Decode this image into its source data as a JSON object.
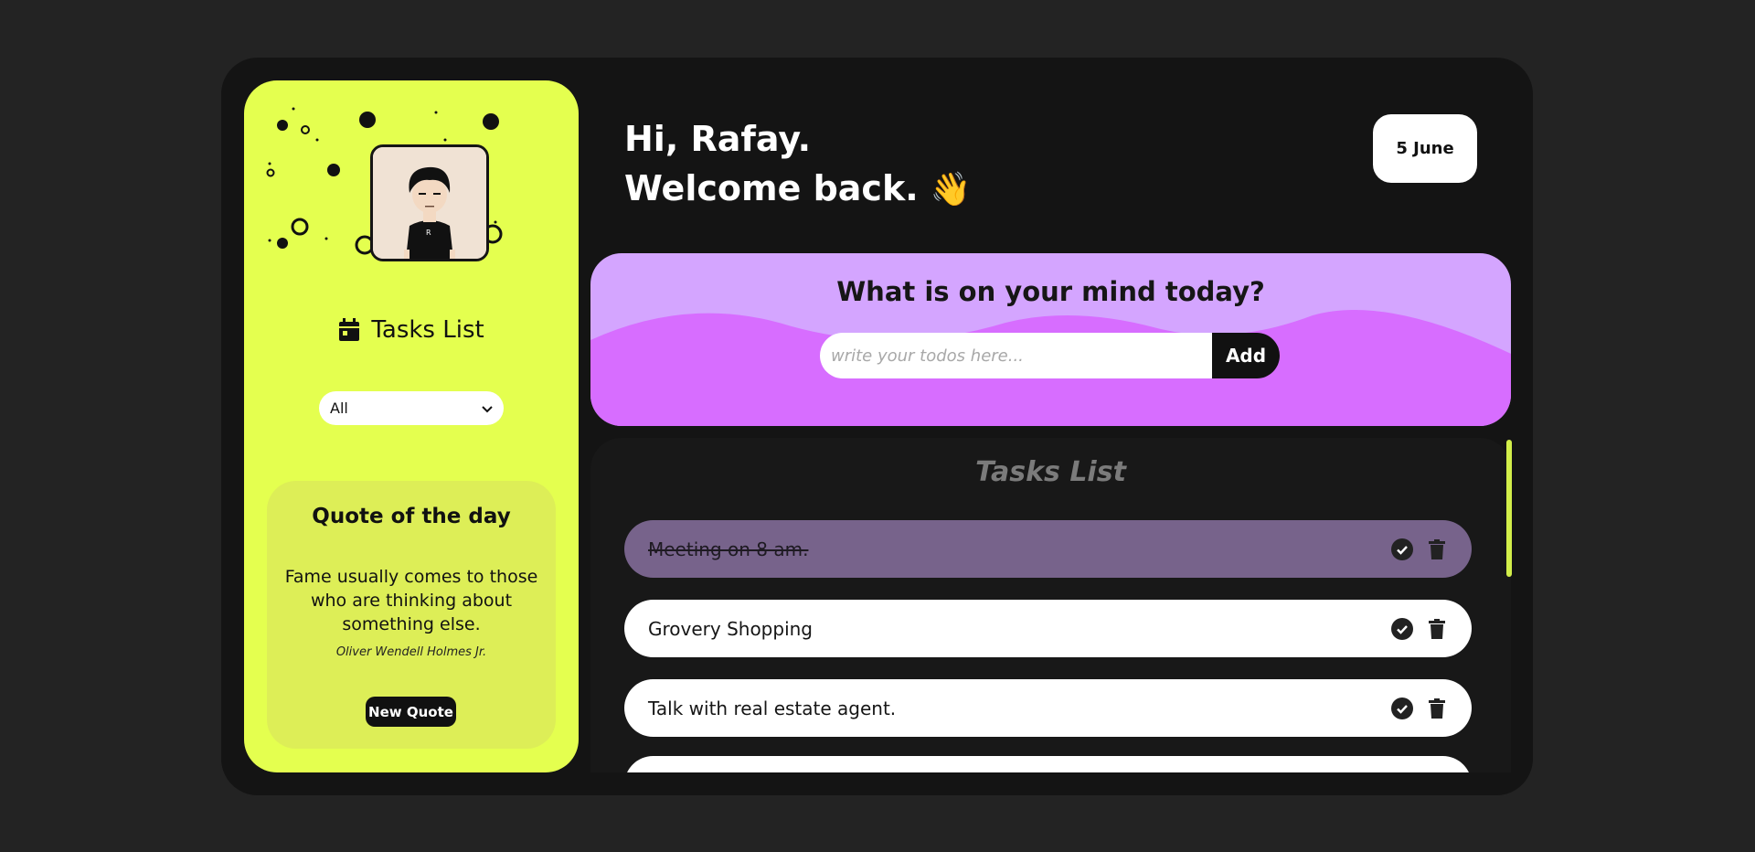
{
  "sidebar": {
    "title": "Tasks List",
    "filter_selected": "All",
    "quote": {
      "heading": "Quote of the day",
      "text": "Fame usually comes to those who are thinking about something else.",
      "author": "Oliver Wendell Holmes Jr.",
      "button_label": "New Quote"
    }
  },
  "header": {
    "greeting_line1": "Hi, Rafay.",
    "greeting_line2": "Welcome back.",
    "wave_emoji": "👋",
    "date": "5 June"
  },
  "composer": {
    "title": "What is on your mind today?",
    "placeholder": "write your todos here...",
    "value": "",
    "add_label": "Add"
  },
  "tasks": {
    "title": "Tasks List",
    "items": [
      {
        "text": "Meeting on 8 am.",
        "done": true
      },
      {
        "text": "Grovery Shopping",
        "done": false
      },
      {
        "text": "Talk with real estate agent.",
        "done": false
      }
    ]
  },
  "colors": {
    "sidebar_bg": "#e4ff4f",
    "banner_light": "#d4a5ff",
    "banner_dark": "#d76dff",
    "done_task": "#77638b",
    "app_bg": "#141414"
  },
  "icons": [
    "calendar-icon",
    "chevron-down-icon",
    "check-circle-icon",
    "trash-icon",
    "wave-emoji"
  ]
}
